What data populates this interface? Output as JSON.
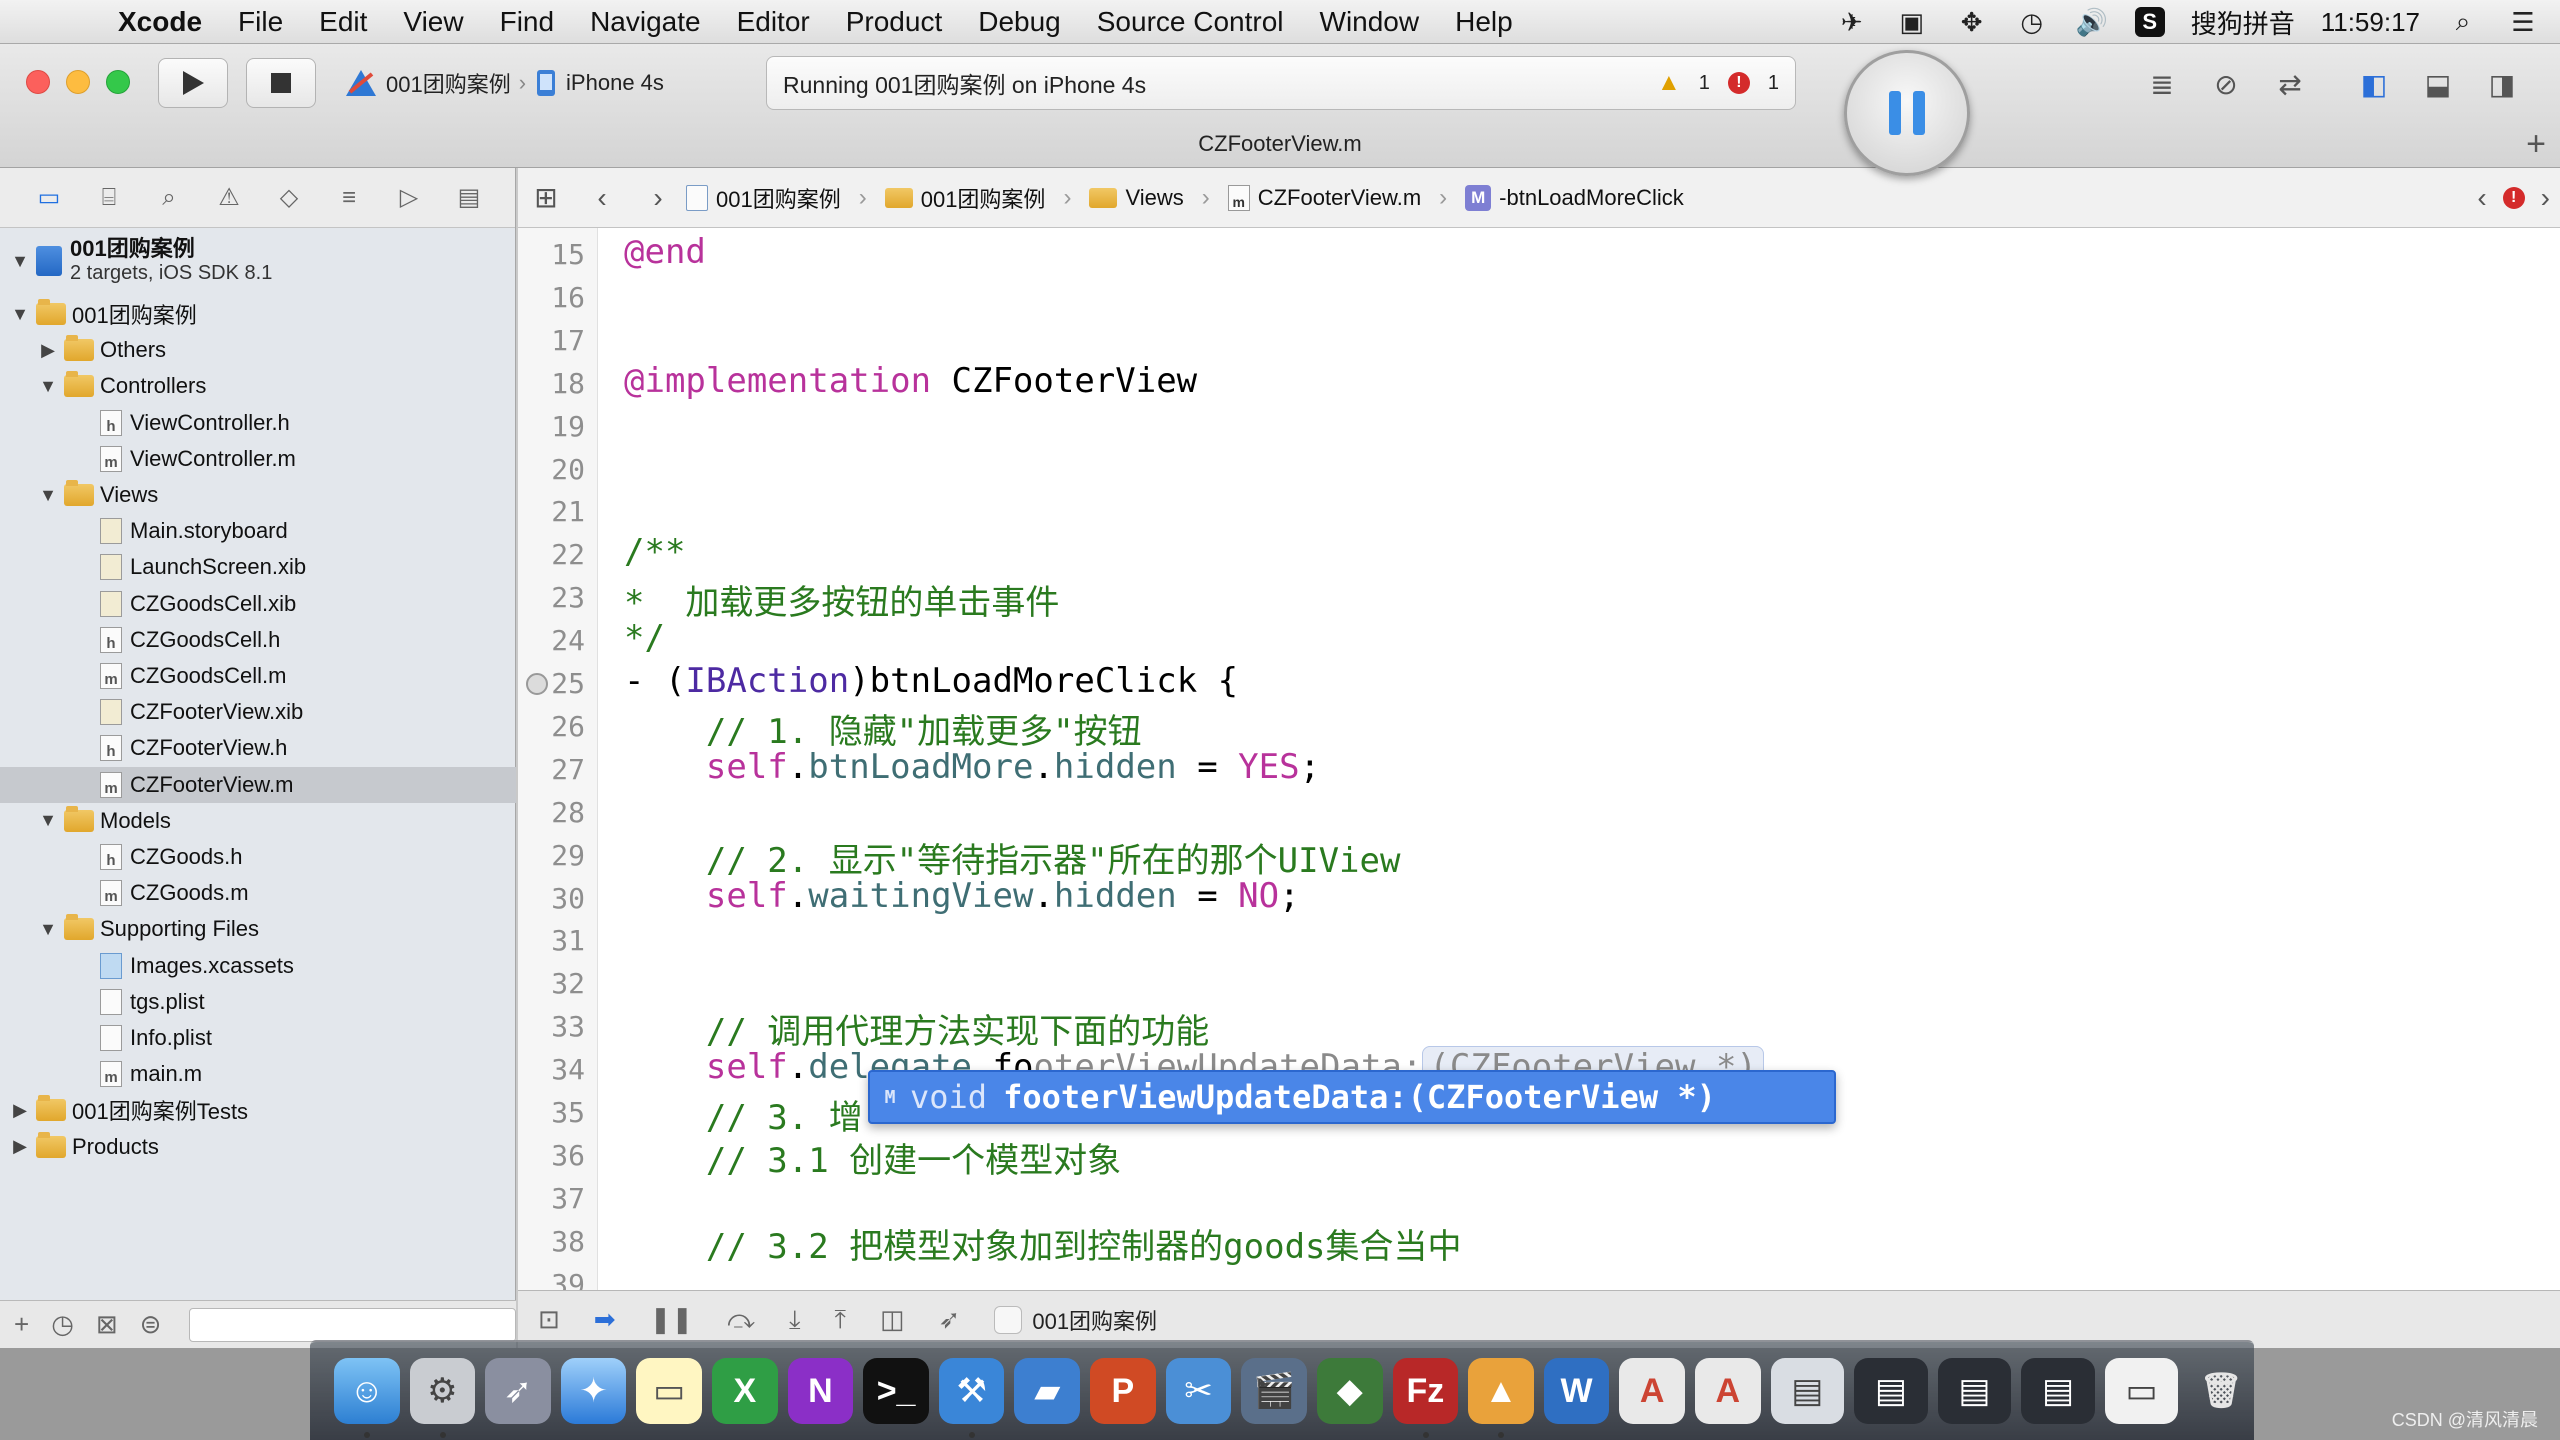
{
  "menubar": {
    "app": "Xcode",
    "items": [
      "File",
      "Edit",
      "View",
      "Find",
      "Navigate",
      "Editor",
      "Product",
      "Debug",
      "Source Control",
      "Window",
      "Help"
    ],
    "ime_label": "搜狗拼音",
    "ime_badge": "S",
    "clock": "11:59:17"
  },
  "toolbar": {
    "scheme_name": "001团购案例",
    "device": "iPhone 4s",
    "status_text": "Running 001团购案例 on iPhone 4s",
    "warning_count": "1",
    "error_count": "1",
    "window_title": "CZFooterView.m",
    "add_tab": "+"
  },
  "navigator": {
    "project": {
      "name": "001团购案例",
      "subtitle": "2 targets, iOS SDK 8.1"
    },
    "rows": [
      {
        "label": "001团购案例",
        "kind": "folder",
        "depth": 1,
        "expanded": true
      },
      {
        "label": "Others",
        "kind": "folder",
        "depth": 2,
        "expanded": false
      },
      {
        "label": "Controllers",
        "kind": "folder",
        "depth": 2,
        "expanded": true
      },
      {
        "label": "ViewController.h",
        "kind": "h",
        "depth": 3
      },
      {
        "label": "ViewController.m",
        "kind": "m",
        "depth": 3
      },
      {
        "label": "Views",
        "kind": "folder",
        "depth": 2,
        "expanded": true
      },
      {
        "label": "Main.storyboard",
        "kind": "xib",
        "depth": 3
      },
      {
        "label": "LaunchScreen.xib",
        "kind": "xib",
        "depth": 3
      },
      {
        "label": "CZGoodsCell.xib",
        "kind": "xib",
        "depth": 3
      },
      {
        "label": "CZGoodsCell.h",
        "kind": "h",
        "depth": 3
      },
      {
        "label": "CZGoodsCell.m",
        "kind": "m",
        "depth": 3
      },
      {
        "label": "CZFooterView.xib",
        "kind": "xib",
        "depth": 3
      },
      {
        "label": "CZFooterView.h",
        "kind": "h",
        "depth": 3
      },
      {
        "label": "CZFooterView.m",
        "kind": "m",
        "depth": 3,
        "selected": true
      },
      {
        "label": "Models",
        "kind": "folder",
        "depth": 2,
        "expanded": true
      },
      {
        "label": "CZGoods.h",
        "kind": "h",
        "depth": 3
      },
      {
        "label": "CZGoods.m",
        "kind": "m",
        "depth": 3
      },
      {
        "label": "Supporting Files",
        "kind": "folder",
        "depth": 2,
        "expanded": true
      },
      {
        "label": "Images.xcassets",
        "kind": "assets",
        "depth": 3
      },
      {
        "label": "tgs.plist",
        "kind": "plist",
        "depth": 3
      },
      {
        "label": "Info.plist",
        "kind": "plist",
        "depth": 3
      },
      {
        "label": "main.m",
        "kind": "m",
        "depth": 3
      },
      {
        "label": "001团购案例Tests",
        "kind": "folder",
        "depth": 1,
        "expanded": false
      },
      {
        "label": "Products",
        "kind": "folder",
        "depth": 1,
        "expanded": false
      }
    ]
  },
  "jumpbar": {
    "crumbs": [
      "001团购案例",
      "001团购案例",
      "Views",
      "CZFooterView.m",
      "-btnLoadMoreClick"
    ],
    "method_badge": "M",
    "file_badge": "m"
  },
  "editor": {
    "lines": [
      {
        "n": "15",
        "tokens": [
          [
            "kw",
            "@end"
          ]
        ]
      },
      {
        "n": "16",
        "tokens": []
      },
      {
        "n": "17",
        "tokens": []
      },
      {
        "n": "18",
        "tokens": [
          [
            "kw",
            "@implementation"
          ],
          [
            "plain",
            " CZFooterView"
          ]
        ]
      },
      {
        "n": "19",
        "tokens": []
      },
      {
        "n": "20",
        "tokens": []
      },
      {
        "n": "21",
        "tokens": []
      },
      {
        "n": "22",
        "tokens": [
          [
            "cm",
            "/**"
          ]
        ]
      },
      {
        "n": "23",
        "tokens": [
          [
            "cm",
            "*  加载更多按钮的单击事件"
          ]
        ]
      },
      {
        "n": "24",
        "tokens": [
          [
            "cm",
            "*/"
          ]
        ]
      },
      {
        "n": "25",
        "tokens": [
          [
            "plain",
            "- ("
          ],
          [
            "ty",
            "IBAction"
          ],
          [
            "plain",
            ")btnLoadMoreClick {"
          ]
        ],
        "marker": true
      },
      {
        "n": "26",
        "tokens": [
          [
            "cm",
            "    // 1. 隐藏\"加载更多\"按钮"
          ]
        ]
      },
      {
        "n": "27",
        "tokens": [
          [
            "kw",
            "    self"
          ],
          [
            "plain",
            "."
          ],
          [
            "prop",
            "btnLoadMore"
          ],
          [
            "plain",
            "."
          ],
          [
            "prop",
            "hidden"
          ],
          [
            "plain",
            " = "
          ],
          [
            "kw",
            "YES"
          ],
          [
            "plain",
            ";"
          ]
        ]
      },
      {
        "n": "28",
        "tokens": []
      },
      {
        "n": "29",
        "tokens": [
          [
            "cm",
            "    // 2. 显示\"等待指示器\"所在的那个UIView"
          ]
        ]
      },
      {
        "n": "30",
        "tokens": [
          [
            "kw",
            "    self"
          ],
          [
            "plain",
            "."
          ],
          [
            "prop",
            "waitingView"
          ],
          [
            "plain",
            "."
          ],
          [
            "prop",
            "hidden"
          ],
          [
            "plain",
            " = "
          ],
          [
            "kw",
            "NO"
          ],
          [
            "plain",
            ";"
          ]
        ]
      },
      {
        "n": "31",
        "tokens": []
      },
      {
        "n": "32",
        "tokens": []
      },
      {
        "n": "33",
        "tokens": [
          [
            "cm",
            "    // 调用代理方法实现下面的功能"
          ]
        ]
      },
      {
        "n": "34",
        "tokens": [
          [
            "kw",
            "    self"
          ],
          [
            "plain",
            "."
          ],
          [
            "prop",
            "delegate"
          ],
          [
            "plain",
            " fo"
          ],
          [
            "ghost",
            "oterViewUpdateData:"
          ],
          [
            "ph",
            "(CZFooterView *)"
          ]
        ]
      },
      {
        "n": "35",
        "tokens": [
          [
            "cm",
            "    // 3. 增"
          ]
        ]
      },
      {
        "n": "36",
        "tokens": [
          [
            "cm",
            "    // 3.1 创建一个模型对象"
          ]
        ]
      },
      {
        "n": "37",
        "tokens": []
      },
      {
        "n": "38",
        "tokens": [
          [
            "cm",
            "    // 3.2 把模型对象加到控制器的goods集合当中"
          ]
        ]
      },
      {
        "n": "39",
        "tokens": []
      }
    ],
    "completion": {
      "kind": "M",
      "type": "void",
      "signature": "footerViewUpdateData:(CZFooterView *)"
    }
  },
  "debugbar": {
    "process": "001团购案例"
  },
  "watermark": "CSDN @清风清晨",
  "colors": {
    "keyword": "#b8329b",
    "comment": "#2a7a1f",
    "selection": "#4a86e8",
    "accent": "#1f6fe0"
  }
}
